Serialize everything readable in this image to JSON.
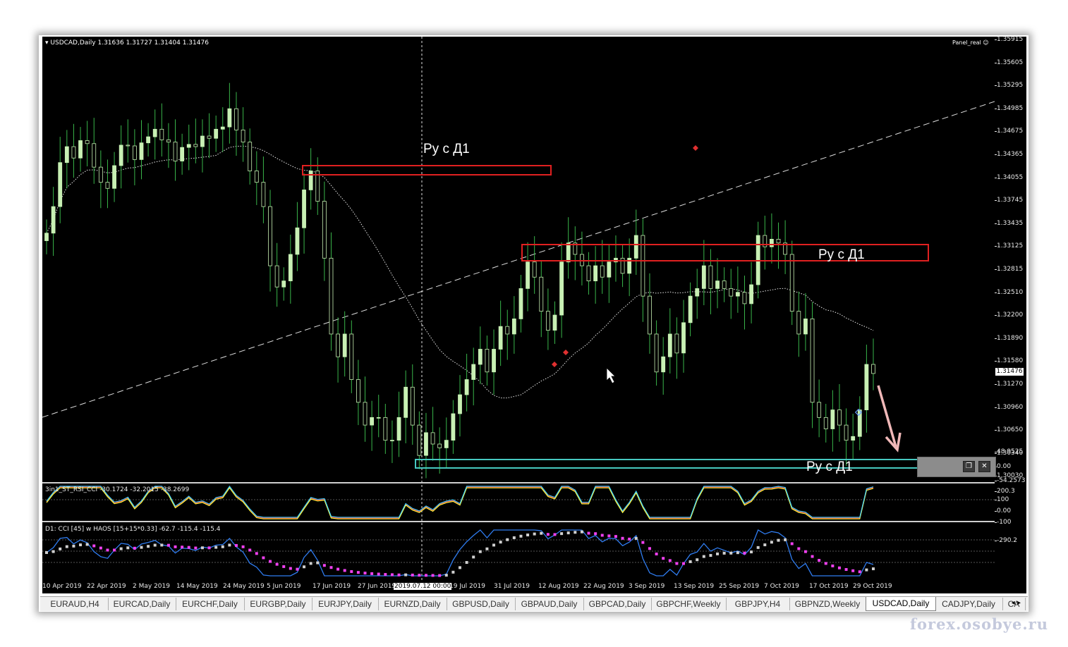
{
  "window": {
    "symbol_line": "USDCAD,Daily  1.31636 1.31727 1.31404 1.31476",
    "panel_name": "Panel_real",
    "watermark": "forex.osobye.ru"
  },
  "zones": [
    {
      "label": "Ру с Д1",
      "color": "#e02020"
    },
    {
      "label": "Ру с Д1",
      "color": "#e02020"
    },
    {
      "label": "Ру с Д1",
      "color": "#46c8c0"
    }
  ],
  "price_axis": {
    "ticks": [
      "1.35915",
      "1.35605",
      "1.35295",
      "1.34985",
      "1.34675",
      "1.34365",
      "1.34055",
      "1.33745",
      "1.33435",
      "1.33125",
      "1.32815",
      "1.32510",
      "1.32200",
      "1.31890",
      "1.31580",
      "1.31270",
      "1.30960",
      "1.30650",
      "1.30340",
      "1.30030"
    ],
    "current": "1.31476"
  },
  "indicators": {
    "rsi": {
      "label": "3in1_ST_RSI_CCI -30.1724 -32.2015 -38.2699",
      "ticks": [
        "48.9525",
        "0.00",
        "-54.2573"
      ]
    },
    "cci": {
      "label": "D1: CCI [45] w HAOS [15+15*0.33] -62.7 -115.4 -115.4",
      "ticks": [
        "200.3",
        "100",
        "0.00",
        "-100",
        "-290.2"
      ]
    }
  },
  "time_axis": {
    "labels": [
      "10 Apr 2019",
      "22 Apr 2019",
      "2 May 2019",
      "14 May 2019",
      "24 May 2019",
      "5 Jun 2019",
      "17 Jun 2019",
      "27 Jun 2019",
      "2019.07.12 00:00",
      "19 Jul 2019",
      "31 Jul 2019",
      "12 Aug 2019",
      "22 Aug 2019",
      "3 Sep 2019",
      "13 Sep 2019",
      "25 Sep 2019",
      "7 Oct 2019",
      "17 Oct 2019",
      "29 Oct 2019"
    ]
  },
  "tabs": [
    "EURAUD,H4",
    "EURCAD,Daily",
    "EURCHF,Daily",
    "EURGBP,Daily",
    "EURJPY,Daily",
    "EURNZD,Daily",
    "GBPUSD,Daily",
    "GBPAUD,Daily",
    "GBPCAD,Daily",
    "GBPCHF,Weekly",
    "GBPJPY,H4",
    "GBPNZD,Weekly",
    "USDCAD,Daily",
    "CADJPY,Daily",
    "CA"
  ],
  "active_tab": "USDCAD,Daily",
  "colors": {
    "bull": "#c8f0b4",
    "bear_wick": "#39b54a",
    "zone_red": "#e02020",
    "zone_cyan": "#46c8c0",
    "arrow": "#f0b8b8",
    "cci_line": "#2f7cf0",
    "haos_up": "#d0d0d0",
    "haos_down": "#f040f0"
  },
  "chart_data": {
    "type": "candlestick",
    "series": [
      {
        "values": [
          1.3333,
          1.3368,
          1.3426,
          1.3447,
          1.3432,
          1.3455,
          1.3451,
          1.342,
          1.34,
          1.3392,
          1.3422,
          1.3449,
          1.3448,
          1.343,
          1.3452,
          1.346,
          1.347,
          1.3456,
          1.3453,
          1.3428,
          1.3446,
          1.345,
          1.3447,
          1.3461,
          1.3458,
          1.347,
          1.3473,
          1.3497,
          1.3469,
          1.3453,
          1.3415,
          1.34,
          1.3368,
          1.329,
          1.3262,
          1.327,
          1.3305,
          1.334,
          1.339,
          1.3415,
          1.3375,
          1.33,
          1.32,
          1.317,
          1.32,
          1.314,
          1.311,
          1.308,
          1.309,
          1.309,
          1.306,
          1.306,
          1.309,
          1.313,
          1.308,
          1.304,
          1.307,
          1.3055,
          1.305,
          1.306,
          1.3095,
          1.312,
          1.314,
          1.316,
          1.318,
          1.315,
          1.318,
          1.321,
          1.32,
          1.322,
          1.326,
          1.3295,
          1.3275,
          1.323,
          1.3205,
          1.3225,
          1.3295,
          1.332,
          1.3305,
          1.329,
          1.327,
          1.329,
          1.3275,
          1.3295,
          1.33,
          1.328,
          1.33,
          1.333,
          1.325,
          1.32,
          1.315,
          1.317,
          1.32,
          1.3175,
          1.3215,
          1.325,
          1.326,
          1.329,
          1.326,
          1.327,
          1.326,
          1.325,
          1.3255,
          1.324,
          1.3265,
          1.333,
          1.3315,
          1.3325,
          1.332,
          1.3305,
          1.323,
          1.32,
          1.322,
          1.311,
          1.309,
          1.3075,
          1.31,
          1.308,
          1.306,
          1.3065,
          1.31,
          1.316,
          1.3148
        ]
      }
    ],
    "ylim": [
      1.3003,
      1.3592
    ]
  }
}
